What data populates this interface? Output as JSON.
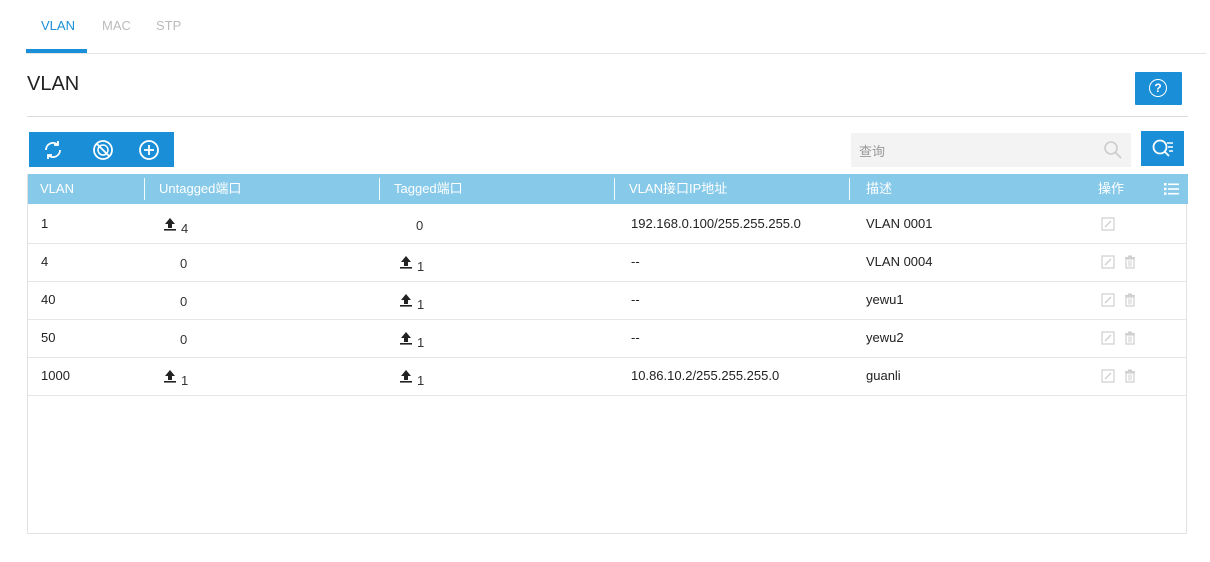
{
  "tabs": [
    {
      "label": "VLAN",
      "active": true
    },
    {
      "label": "MAC",
      "active": false
    },
    {
      "label": "STP",
      "active": false
    }
  ],
  "page": {
    "title": "VLAN"
  },
  "colors": {
    "accent": "#1a8fd8",
    "header": "#86c9e8"
  },
  "toolbar": {
    "icons": [
      "refresh-icon",
      "disable-icon",
      "add-icon"
    ]
  },
  "search": {
    "placeholder": "查询"
  },
  "table": {
    "columns": [
      "VLAN",
      "Untagged端口",
      "Tagged端口",
      "VLAN接口IP地址",
      "描述",
      "操作"
    ],
    "rows": [
      {
        "vlan": "1",
        "untagged": "4",
        "tagged": "0",
        "ip": "192.168.0.100/255.255.255.0",
        "desc": "VLAN 0001"
      },
      {
        "vlan": "4",
        "untagged": "0",
        "tagged": "1",
        "ip": "--",
        "desc": "VLAN 0004"
      },
      {
        "vlan": "40",
        "untagged": "0",
        "tagged": "1",
        "ip": "--",
        "desc": "yewu1"
      },
      {
        "vlan": "50",
        "untagged": "0",
        "tagged": "1",
        "ip": "--",
        "desc": "yewu2"
      },
      {
        "vlan": "1000",
        "untagged": "1",
        "tagged": "1",
        "ip": "10.86.10.2/255.255.255.0",
        "desc": "guanli"
      }
    ]
  }
}
